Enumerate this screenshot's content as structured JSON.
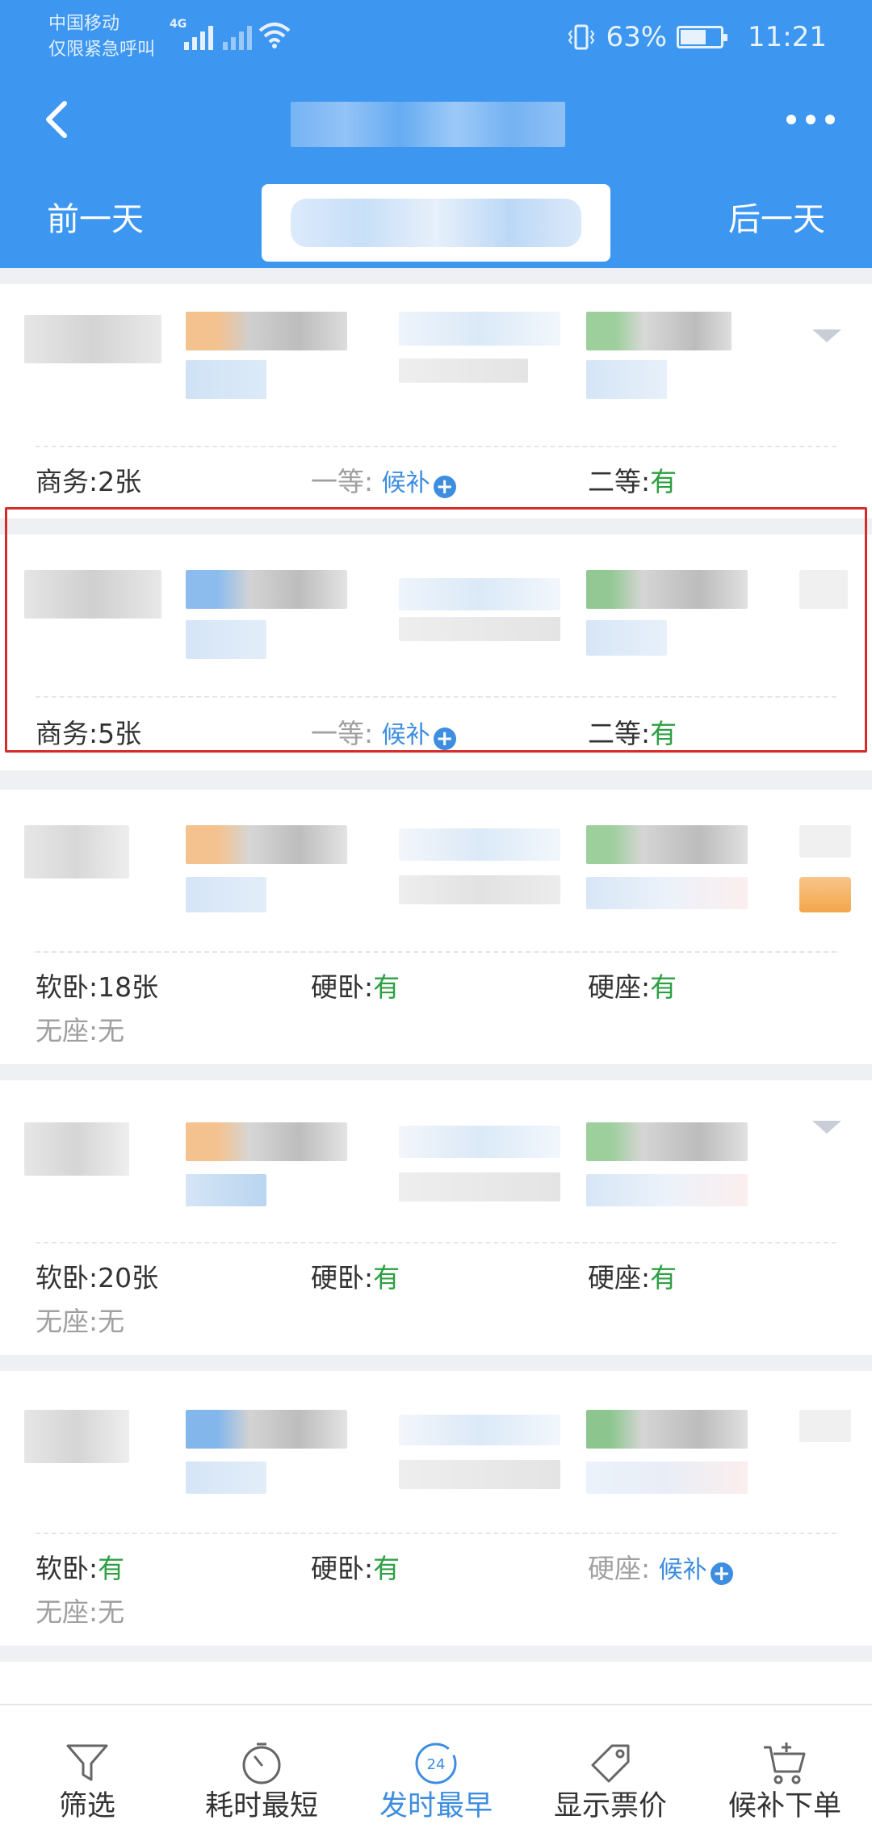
{
  "status_bar": {
    "carrier_line1": "中国移动",
    "carrier_line2": "仅限紧急呼叫",
    "network": "4G",
    "battery": "63%",
    "time": "11:21"
  },
  "nav": {
    "back_icon": "chevron-left-icon",
    "more_icon": "more-horizontal-icon"
  },
  "date_nav": {
    "prev_label": "前一天",
    "next_label": "后一天"
  },
  "trains": [
    {
      "seats": [
        {
          "label": "商务:",
          "value": "2张",
          "style": "normal"
        },
        {
          "label": "一等:",
          "value": "候补",
          "style": "waitlist"
        },
        {
          "label": "二等:",
          "value": "有",
          "style": "available"
        }
      ]
    },
    {
      "seats": [
        {
          "label": "商务:",
          "value": "5张",
          "style": "normal"
        },
        {
          "label": "一等:",
          "value": "候补",
          "style": "waitlist"
        },
        {
          "label": "二等:",
          "value": "有",
          "style": "available"
        }
      ]
    },
    {
      "seats": [
        {
          "label": "软卧:",
          "value": "18张",
          "style": "normal"
        },
        {
          "label": "硬卧:",
          "value": "有",
          "style": "available"
        },
        {
          "label": "硬座:",
          "value": "有",
          "style": "available"
        },
        {
          "label": "无座:",
          "value": "无",
          "style": "none"
        }
      ]
    },
    {
      "seats": [
        {
          "label": "软卧:",
          "value": "20张",
          "style": "normal"
        },
        {
          "label": "硬卧:",
          "value": "有",
          "style": "available"
        },
        {
          "label": "硬座:",
          "value": "有",
          "style": "available"
        },
        {
          "label": "无座:",
          "value": "无",
          "style": "none"
        }
      ]
    },
    {
      "seats": [
        {
          "label": "软卧:",
          "value": "有",
          "style": "available"
        },
        {
          "label": "硬卧:",
          "value": "有",
          "style": "available"
        },
        {
          "label": "硬座:",
          "value": "候补",
          "style": "waitlist"
        },
        {
          "label": "无座:",
          "value": "无",
          "style": "none"
        }
      ]
    }
  ],
  "toolbar": {
    "items": [
      {
        "label": "筛选",
        "icon": "filter-icon"
      },
      {
        "label": "耗时最短",
        "icon": "timer-icon"
      },
      {
        "label": "发时最早",
        "icon": "clock-24-icon",
        "icon_text": "24",
        "active": true
      },
      {
        "label": "显示票价",
        "icon": "price-tag-icon"
      },
      {
        "label": "候补下单",
        "icon": "cart-add-icon"
      }
    ]
  },
  "colors": {
    "header_blue": "#3d97f0",
    "available_green": "#2ea043",
    "waitlist_blue": "#3d8de0",
    "highlight_red": "#d62b2b"
  }
}
